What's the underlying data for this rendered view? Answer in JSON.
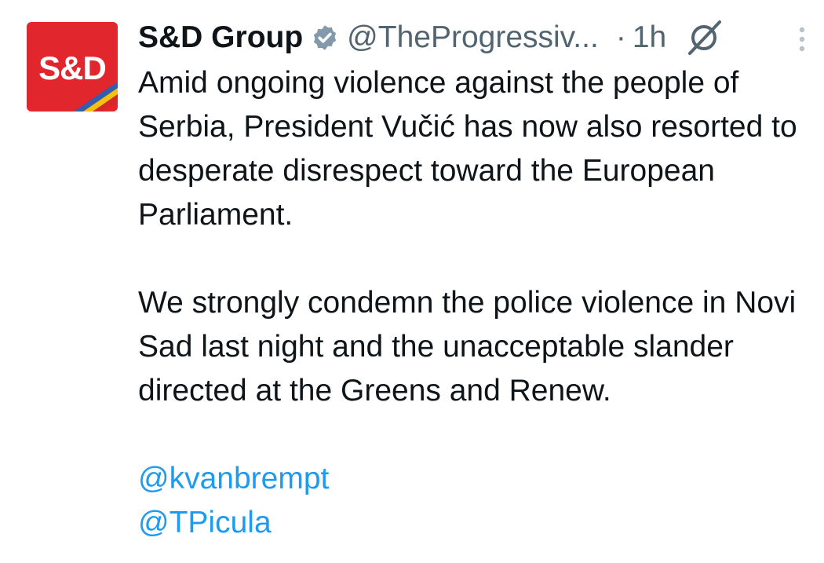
{
  "author": {
    "avatar_text": "S&D",
    "display_name": "S&D Group",
    "handle": "@TheProgressiv...",
    "separator": "·",
    "time": "1h",
    "verified_icon": "verified-badge-icon",
    "colors": {
      "avatar_red": "#e1262d",
      "stripe_blue": "#2f5fae",
      "stripe_yellow": "#f4c20d",
      "stripe_red": "#d62828"
    }
  },
  "tweet": {
    "paragraphs": [
      "Amid ongoing violence against the people of Serbia, President Vučić has now also resorted to desperate disrespect toward the European Parliament.",
      "We strongly condemn the police violence in Novi Sad last night and the unacceptable slander directed at the Greens and Renew."
    ],
    "mentions": [
      "@kvanbrempt",
      "@TPicula"
    ]
  },
  "icons": {
    "grok": "grok-icon",
    "more": "more-options-icon"
  },
  "theme": {
    "text": "#0f1419",
    "muted": "#536471",
    "link": "#1d9bf0"
  }
}
